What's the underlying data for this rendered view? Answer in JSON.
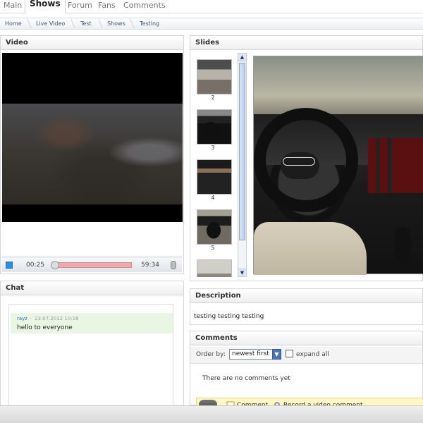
{
  "tabs": [
    "Main",
    "Shows",
    "Forum",
    "Fans",
    "Comments"
  ],
  "breadcrumb": [
    "Home",
    "Live Video",
    "Test",
    "Shows",
    "Testing"
  ],
  "video": {
    "title": "Video",
    "current_time": "00:25",
    "duration": "59:34",
    "progress": 0.007
  },
  "chat": {
    "title": "Chat",
    "message": {
      "user": "rayz",
      "separator": "-",
      "date": "23.07.2012 10:16",
      "text": "hello to everyone"
    }
  },
  "slides": {
    "title": "Slides",
    "thumbnails": [
      "2",
      "3",
      "4",
      "5"
    ],
    "scroll_up": "▲",
    "scroll_down": "▼"
  },
  "description": {
    "title": "Description",
    "text": "testing testing testing"
  },
  "comments": {
    "title": "Comments",
    "order_label": "Order by:",
    "order_value": "newest first",
    "expand_label": "expand all",
    "empty_text": "There are no comments yet",
    "comment_label": "Comment",
    "record_label": "Record a video comment"
  },
  "icons": {
    "select_arrow": "▼"
  }
}
